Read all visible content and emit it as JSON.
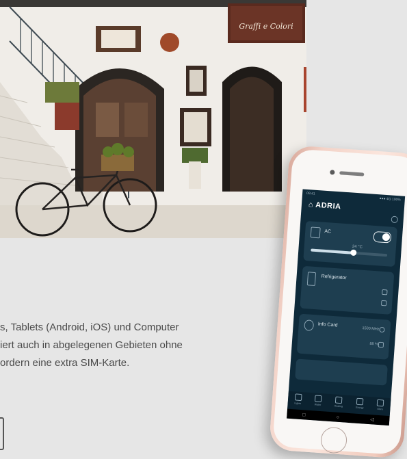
{
  "article": {
    "lines": [
      "s, Tablets (Android, iOS) und Computer",
      "iert auch in abgelegenen Gebieten ohne",
      "ordern eine extra SIM-Karte."
    ]
  },
  "photo": {
    "sign_text": "Graffi e Colori"
  },
  "phone": {
    "status_left": "09:41",
    "status_right": "●●● 4G 100%",
    "brand": "ADRIA",
    "cards": {
      "ac": {
        "title": "AC",
        "temperature": "24 °C",
        "level": 0.55
      },
      "refrigerator": {
        "title": "Refrigerator"
      },
      "info_card": {
        "title": "Info Card",
        "readout_1": "1500 MHz",
        "readout_2": "88 %"
      }
    },
    "tabs": [
      "Lights",
      "Water",
      "Heating",
      "Energy",
      "More"
    ],
    "nav": {
      "back": "◁",
      "home": "○",
      "recent": "□"
    }
  },
  "colors": {
    "app_bg": "#0e2a3a",
    "card_bg": "#1e3e50",
    "frame": "#f3d3c8"
  }
}
